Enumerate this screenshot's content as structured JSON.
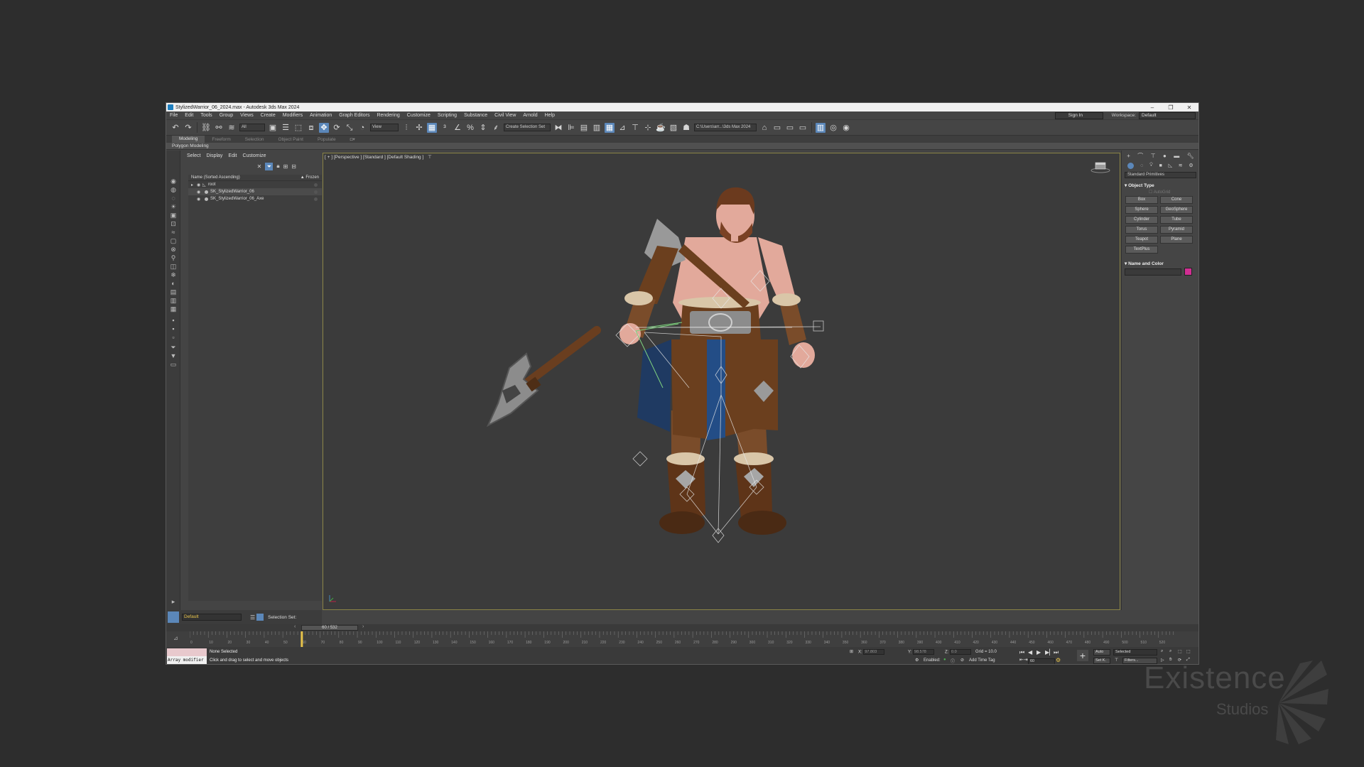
{
  "window": {
    "title": "StylizedWarrior_06_2024.max - Autodesk 3ds Max 2024",
    "minimize": "–",
    "maximize": "❐",
    "close": "✕"
  },
  "menubar": {
    "items": [
      "File",
      "Edit",
      "Tools",
      "Group",
      "Views",
      "Create",
      "Modifiers",
      "Animation",
      "Graph Editors",
      "Rendering",
      "Customize",
      "Scripting",
      "Substance",
      "Civil View",
      "Arnold",
      "Help"
    ],
    "sign_in": "Sign In",
    "workspace_label": "Workspace:",
    "workspace_value": "Default"
  },
  "toolbar": {
    "filter_value": "All",
    "refcoord_value": "View",
    "selection_set_placeholder": "Create Selection Set",
    "project_path": "C:\\Users\\arr...\\3ds Max 2024"
  },
  "ribbon": {
    "tabs": [
      "Modeling",
      "Freeform",
      "Selection",
      "Object Paint",
      "Populate"
    ],
    "active_tab": "Modeling",
    "sub_label": "Polygon Modeling"
  },
  "explorer": {
    "tabs": [
      "Select",
      "Display",
      "Edit",
      "Customize"
    ],
    "header_name": "Name (Sorted Ascending)",
    "header_frozen": "▲ Frozen",
    "rows": [
      {
        "label": "root"
      },
      {
        "label": "SK_StylizedWarrior_06"
      },
      {
        "label": "SK_StylizedWarrior_06_Axe"
      }
    ],
    "layer_value": "Default",
    "selection_set_label": "Selection Set:"
  },
  "viewport": {
    "label": "[ + ] [Perspective ] [Standard ] [Default Shading ]",
    "filter_icon": "⊤"
  },
  "command_panel": {
    "dropdown": "Standard Primitives",
    "object_type_title": "Object Type",
    "autogrid": "AutoGrid",
    "primitives": [
      "Box",
      "Cone",
      "Sphere",
      "GeoSphere",
      "Cylinder",
      "Tube",
      "Torus",
      "Pyramid",
      "Teapot",
      "Plane",
      "TextPlus"
    ],
    "name_color_title": "Name and Color",
    "object_color": "#d02e92"
  },
  "timeline": {
    "frame_display": "60 / 532",
    "ticks": [
      "0",
      "10",
      "20",
      "30",
      "40",
      "50",
      "60",
      "70",
      "80",
      "90",
      "100",
      "110",
      "120",
      "130",
      "140",
      "150",
      "160",
      "170",
      "180",
      "190",
      "200",
      "210",
      "220",
      "230",
      "240",
      "250",
      "260",
      "270",
      "280",
      "290",
      "300",
      "310",
      "320",
      "330",
      "340",
      "350",
      "360",
      "370",
      "380",
      "390",
      "400",
      "410",
      "420",
      "430",
      "440",
      "450",
      "460",
      "470",
      "480",
      "490",
      "500",
      "510",
      "520",
      "530"
    ]
  },
  "status": {
    "maxscript_text": "Array modifier",
    "line1": "None Selected",
    "line2": "Click and drag to select and move objects",
    "x_label": "X:",
    "y_label": "Y:",
    "z_label": "Z:",
    "x_value": "97.803",
    "y_value": "98.578",
    "z_value": "0.0",
    "grid": "Grid = 10.0",
    "enabled": "Enabled:",
    "add_time_tag": "Add Time Tag",
    "auto": "Auto",
    "selected": "Selected",
    "set_k": "Set K.",
    "filters": "Filters...",
    "frame_field": "60"
  },
  "watermark": {
    "line1": "Existence",
    "line2": "Studios"
  }
}
